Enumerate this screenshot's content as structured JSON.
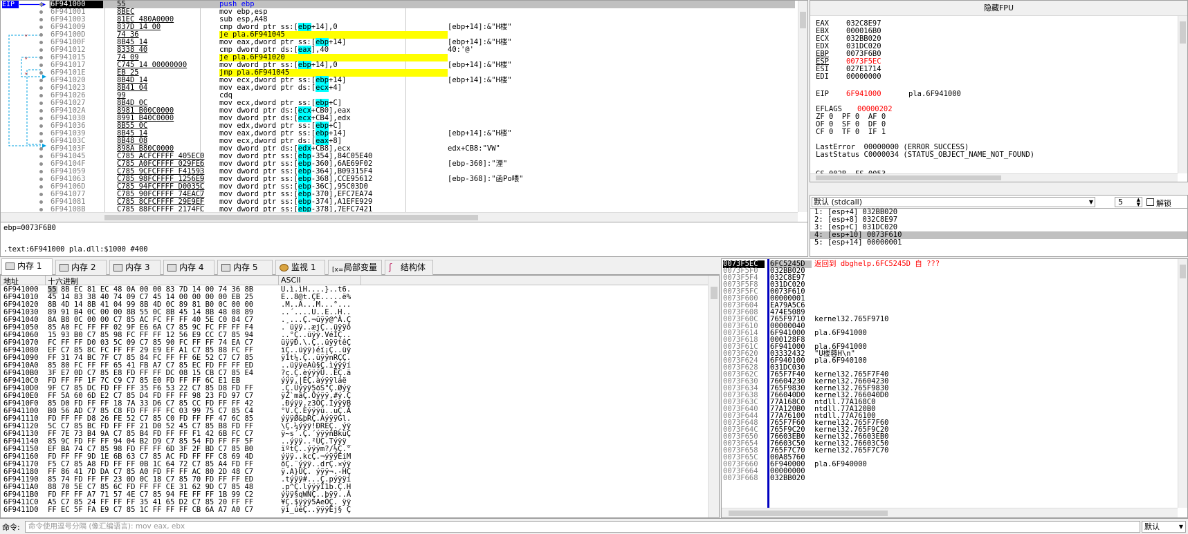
{
  "cpu": {
    "eip_tag": "EIP",
    "rows": [
      {
        "addr": "6F941000",
        "bytes": "55",
        "asm": "push ebp",
        "comment": "",
        "sel": true
      },
      {
        "addr": "6F941001",
        "bytes": "8BEC",
        "asm": "mov ebp,esp",
        "comment": ""
      },
      {
        "addr": "6F941003",
        "bytes": "81EC 480A0000",
        "asm": "sub esp,A48",
        "comment": ""
      },
      {
        "addr": "6F941009",
        "bytes": "837D 14 00",
        "asm": "cmp dword ptr ss:[ebp+14],0",
        "comment": "[ebp+14]:&\"H楼\""
      },
      {
        "addr": "6F94100D",
        "bytes": "74 36",
        "asm": "je pla.6F941045",
        "comment": "",
        "jump": true,
        "mark": "v"
      },
      {
        "addr": "6F94100F",
        "bytes": "8B45 14",
        "asm": "mov eax,dword ptr ss:[ebp+14]",
        "comment": "[ebp+14]:&\"H楼\""
      },
      {
        "addr": "6F941012",
        "bytes": "8338 40",
        "asm": "cmp dword ptr ds:[eax],40",
        "comment": "40:'@'"
      },
      {
        "addr": "6F941015",
        "bytes": "74 09",
        "asm": "je pla.6F941020",
        "comment": "",
        "jump": true,
        "mark": "v"
      },
      {
        "addr": "6F941017",
        "bytes": "C745 14 00000000",
        "asm": "mov dword ptr ss:[ebp+14],0",
        "comment": "[ebp+14]:&\"H楼\""
      },
      {
        "addr": "6F94101E",
        "bytes": "EB 25",
        "asm": "jmp pla.6F941045",
        "comment": "",
        "jump": true,
        "mark": "v"
      },
      {
        "addr": "6F941020",
        "bytes": "8B4D 14",
        "asm": "mov ecx,dword ptr ss:[ebp+14]",
        "comment": "[ebp+14]:&\"H楼\""
      },
      {
        "addr": "6F941023",
        "bytes": "8B41 04",
        "asm": "mov eax,dword ptr ds:[ecx+4]",
        "comment": ""
      },
      {
        "addr": "6F941026",
        "bytes": "99",
        "asm": "cdq",
        "comment": ""
      },
      {
        "addr": "6F941027",
        "bytes": "8B4D 0C",
        "asm": "mov ecx,dword ptr ss:[ebp+C]",
        "comment": ""
      },
      {
        "addr": "6F94102A",
        "bytes": "8981 B00C0000",
        "asm": "mov dword ptr ds:[ecx+CB0],eax",
        "comment": ""
      },
      {
        "addr": "6F941030",
        "bytes": "8991 B40C0000",
        "asm": "mov dword ptr ds:[ecx+CB4],edx",
        "comment": ""
      },
      {
        "addr": "6F941036",
        "bytes": "8B55 0C",
        "asm": "mov edx,dword ptr ss:[ebp+C]",
        "comment": ""
      },
      {
        "addr": "6F941039",
        "bytes": "8B45 14",
        "asm": "mov eax,dword ptr ss:[ebp+14]",
        "comment": "[ebp+14]:&\"H楼\""
      },
      {
        "addr": "6F94103C",
        "bytes": "8B48 08",
        "asm": "mov ecx,dword ptr ds:[eax+8]",
        "comment": ""
      },
      {
        "addr": "6F94103F",
        "bytes": "898A B80C0000",
        "asm": "mov dword ptr ds:[edx+CB8],ecx",
        "comment": "edx+CB8:\"VW\""
      },
      {
        "addr": "6F941045",
        "bytes": "C785 ACFCFFFF 405EC0",
        "asm": "mov dword ptr ss:[ebp-354],84C05E40",
        "comment": ""
      },
      {
        "addr": "6F94104F",
        "bytes": "C785 A0FCFFFF 029FE6",
        "asm": "mov dword ptr ss:[ebp-360],6AE69F02",
        "comment": "[ebp-360]:\"湮\""
      },
      {
        "addr": "6F941059",
        "bytes": "C785 9CFCFFFF F41593",
        "asm": "mov dword ptr ss:[ebp-364],B09315F4",
        "comment": ""
      },
      {
        "addr": "6F941063",
        "bytes": "C785 98FCFFFF 1256E9",
        "asm": "mov dword ptr ss:[ebp-368],CCE95612",
        "comment": "[ebp-368]:\"函Po喂\""
      },
      {
        "addr": "6F94106D",
        "bytes": "C785 94FCFFFF D0035C",
        "asm": "mov dword ptr ss:[ebp-36C],95C03D0",
        "comment": ""
      },
      {
        "addr": "6F941077",
        "bytes": "C785 90FCFFFF 74EAC7",
        "asm": "mov dword ptr ss:[ebp-370],EFC7EA74",
        "comment": ""
      },
      {
        "addr": "6F941081",
        "bytes": "C785 8CFCFFFF 29E9EF",
        "asm": "mov dword ptr ss:[ebp-374],A1EFE929",
        "comment": ""
      },
      {
        "addr": "6F94108B",
        "bytes": "C785 88FCFFFF 2174FC",
        "asm": "mov dword ptr ss:[ebp-378],7EFC7421",
        "comment": ""
      }
    ]
  },
  "info": {
    "line1": "ebp=0073F6B0",
    "line2": ".text:6F941000 pla.dll:$1000 #400"
  },
  "registers": {
    "title": "隐藏FPU",
    "gp": [
      {
        "n": "EAX",
        "v": "032C8E97"
      },
      {
        "n": "EBX",
        "v": "000016B0"
      },
      {
        "n": "ECX",
        "v": "032BB020"
      },
      {
        "n": "EDX",
        "v": "031DC020"
      },
      {
        "n": "EBP",
        "v": "0073F6B0",
        "u": true
      },
      {
        "n": "ESP",
        "v": "0073F5EC",
        "u": true,
        "red": true
      },
      {
        "n": "ESI",
        "v": "027E1714"
      },
      {
        "n": "EDI",
        "v": "00000000"
      }
    ],
    "eip": {
      "n": "EIP",
      "v": "6F941000",
      "s": "pla.6F941000"
    },
    "eflags": {
      "n": "EFLAGS",
      "v": "00000202"
    },
    "flags": [
      "ZF 0  PF 0  AF 0",
      "OF 0  SF 0  DF 0",
      "CF 0  TF 0  IF 1"
    ],
    "lasterror": "LastError  00000000 (ERROR_SUCCESS)",
    "laststatus": "LastStatus C0000034 (STATUS_OBJECT_NAME_NOT_FOUND)",
    "segs": "GS 002B  FS 0053"
  },
  "callconv": {
    "label": "默认 (stdcall)",
    "count": "5",
    "unlock": "解锁"
  },
  "args": [
    "1: [esp+4] 032BB020",
    "2: [esp+8] 032C8E97",
    "3: [esp+C] 031DC020",
    "4: [esp+10] 0073F610",
    "5: [esp+14] 00000001"
  ],
  "tabs": [
    "内存 1",
    "内存 2",
    "内存 3",
    "内存 4",
    "内存 5",
    "监视 1",
    "局部变量",
    "结构体"
  ],
  "dump": {
    "col_addr": "地址",
    "col_hex": "十六进制",
    "col_ascii": "ASCII",
    "rows": [
      {
        "a": "6F941000",
        "h": "55 8B EC 81 EC 48 0A 00 00 83 7D 14 00 74 36 8B",
        "c": "U.ì.ìH....}..t6."
      },
      {
        "a": "6F941010",
        "h": "45 14 83 38 40 74 09 C7 45 14 00 00 00 00 EB 25",
        "c": "E..8@t.ÇE.....ë%"
      },
      {
        "a": "6F941020",
        "h": "8B 4D 14 8B 41 04 99 8B 4D 0C 89 81 B0 0C 00 00",
        "c": ".M..A...M...°..."
      },
      {
        "a": "6F941030",
        "h": "89 91 B4 0C 00 00 8B 55 0C 8B 45 14 8B 48 08 89",
        "c": "..´....U..E..H.."
      },
      {
        "a": "6F941040",
        "h": "8A B8 0C 00 00 C7 85 AC FC FF FF 40 5E C0 84 C7",
        "c": ".¸...Ç.¬üÿÿ@^À.Ç"
      },
      {
        "a": "6F941050",
        "h": "85 A0 FC FF FF 02 9F E6 6A C7 85 9C FC FF FF F4",
        "c": ". üÿÿ..æjÇ..üÿÿô"
      },
      {
        "a": "6F941060",
        "h": "15 93 B0 C7 85 98 FC FF FF 12 56 E9 CC C7 85 94",
        "c": "..°Ç..üÿÿ.VéÌÇ.."
      },
      {
        "a": "6F941070",
        "h": "FC FF FF D0 03 5C 09 C7 85 90 FC FF FF 74 EA C7",
        "c": "üÿÿÐ.\\.Ç..üÿÿtêÇ"
      },
      {
        "a": "6F941080",
        "h": "EF C7 85 8C FC FF FF 29 E9 EF A1 C7 85 88 FC FF",
        "c": "ïÇ..üÿÿ)éï¡Ç..üÿ"
      },
      {
        "a": "6F941090",
        "h": "FF 31 74 BC 7F C7 85 84 FC FF FF 6E 52 C7 C7 85",
        "c": "ÿ1t¼.Ç..üÿÿnRÇÇ."
      },
      {
        "a": "6F9410A0",
        "h": "85 80 FC FF FF 65 41 FB A7 C7 85 EC FD FF FF ED",
        "c": "..üÿÿeAû§Ç.ìýÿÿí"
      },
      {
        "a": "6F9410B0",
        "h": "3F E7 0D C7 85 E8 FD FF FF DC 08 15 CB C7 85 E4",
        "c": "?ç.Ç.èýÿÿÜ..ËÇ.ä"
      },
      {
        "a": "6F9410C0",
        "h": "FD FF FF 1F 7C C9 C7 85 E0 FD FF FF 6C E1 EB",
        "c": "ýÿÿ.|ÉÇ.àýÿÿláë"
      },
      {
        "a": "6F9410D0",
        "h": "9F C7 85 DC FD FF FF 35 F6 53 22 C7 85 D8 FD FF",
        "c": ".Ç.Üýÿÿ5öS\"Ç.Øýÿ"
      },
      {
        "a": "6F9410E0",
        "h": "FF 5A 60 6D E2 C7 85 D4 FD FF FF 98 23 FD 97 C7",
        "c": "ÿZ`mâÇ.Ôýÿÿ.#ý.Ç"
      },
      {
        "a": "6F9410F0",
        "h": "85 D0 FD FF FF 18 7A 33 D6 C7 85 CC FD FF FF 42",
        "c": ".Ðýÿÿ.z3ÖÇ.ÌýÿÿB"
      },
      {
        "a": "6F941100",
        "h": "B0 56 AD C7 85 C8 FD FF FF FC 03 99 75 C7 85 C4",
        "c": "°V.Ç.Èýÿÿü..uÇ.Ä"
      },
      {
        "a": "6F941110",
        "h": "FD FF FF D8 26 FE 52 C7 85 C0 FD FF FF 47 6C 85",
        "c": "ýÿÿØ&þRÇ.ÀýÿÿGl."
      },
      {
        "a": "6F941120",
        "h": "5C C7 85 BC FD FF FF 21 D0 52 45 C7 85 B8 FD FF",
        "c": "\\Ç.¼ýÿÿ!ÐREÇ.¸ýÿ"
      },
      {
        "a": "6F941130",
        "h": "FF 7E 73 B4 9A C7 85 B4 FD FF FF F1 42 6B FC C7",
        "c": "ÿ~s´.Ç.´ýÿÿñBküÇ"
      },
      {
        "a": "6F941140",
        "h": "85 9C FD FF FF 94 04 B2 D9 C7 85 54 FD FF FF 5F",
        "c": "..ýÿÿ..²ÙÇ.Týÿÿ_"
      },
      {
        "a": "6F941150",
        "h": "EF BA 74 C7 85 98 FD FF FF 6D 3F 2F BD C7 85 B0",
        "c": "ïºtÇ..ýÿÿm?/½Ç.°"
      },
      {
        "a": "6F941160",
        "h": "FD FF FF 9D 1E 6B 63 C7 85 AC FD FF FF C8 69 4D",
        "c": "ýÿÿ..kcÇ.¬ýÿÿÈiM"
      },
      {
        "a": "6F941170",
        "h": "F5 C7 85 A8 FD FF FF 0B 1C 64 72 C7 85 A4 FD FF",
        "c": "õÇ.¨ýÿÿ..drÇ.¤ýÿ"
      },
      {
        "a": "6F941180",
        "h": "FF 86 41 7D DA C7 85 A0 FD FF FF AC 80 2D 48 C7",
        "c": "ÿ.A}ÚÇ. ýÿÿ¬.-HÇ"
      },
      {
        "a": "6F941190",
        "h": "85 74 FD FF FF 23 0D 0C 18 C7 85 70 FD FF FF ED",
        "c": ".týÿÿ#...Ç.pýÿÿí"
      },
      {
        "a": "6F9411A0",
        "h": "88 70 5E C7 85 6C FD FF FF CE 31 62 9D C7 85 48",
        "c": ".p^Ç.lýÿÿÎ1b.Ç.H"
      },
      {
        "a": "6F9411B0",
        "h": "FD FF FF A7 71 57 4E C7 85 94 FE FF FF 1B 99 C2",
        "c": "ýÿÿ§qWNÇ..þÿÿ..Â"
      },
      {
        "a": "6F9411C0",
        "h": "A5 C7 85 24 FF FF FF 35 41 65 D2 C7 85 20 FF FF",
        "c": "¥Ç.$ÿÿÿ5AeÒÇ. ÿÿ"
      },
      {
        "a": "6F9411D0",
        "h": "FF EC 5F FA E9 C7 85 1C FF FF FF CB 6A A7 A0 C7",
        "c": "ÿì_úéÇ..ÿÿÿËj§ Ç"
      }
    ]
  },
  "stack": {
    "rows": [
      {
        "a": "0073F5EC",
        "v": "6FC5245D",
        "c": "返回到 dbghelp.6FC5245D 自 ???",
        "sel": true,
        "cred": true
      },
      {
        "a": "0073F5F0",
        "v": "032BB020",
        "c": ""
      },
      {
        "a": "0073F5F4",
        "v": "032C8E97",
        "c": ""
      },
      {
        "a": "0073F5F8",
        "v": "031DC020",
        "c": ""
      },
      {
        "a": "0073F5FC",
        "v": "0073F610",
        "c": ""
      },
      {
        "a": "0073F600",
        "v": "00000001",
        "c": ""
      },
      {
        "a": "0073F604",
        "v": "EA79A5C6",
        "c": ""
      },
      {
        "a": "0073F608",
        "v": "474E5089",
        "c": ""
      },
      {
        "a": "0073F60C",
        "v": "765F9710",
        "c": "kernel32.765F9710",
        "ared": true
      },
      {
        "a": "0073F610",
        "v": "00000040",
        "c": ""
      },
      {
        "a": "0073F614",
        "v": "6F941000",
        "c": "pla.6F941000"
      },
      {
        "a": "0073F618",
        "v": "000128F8",
        "c": ""
      },
      {
        "a": "0073F61C",
        "v": "6F941000",
        "c": "pla.6F941000"
      },
      {
        "a": "0073F620",
        "v": "03332432",
        "c": "\"U楼蓉H\\n\""
      },
      {
        "a": "0073F624",
        "v": "6F940100",
        "c": "pla.6F940100"
      },
      {
        "a": "0073F628",
        "v": "031DC030",
        "c": ""
      },
      {
        "a": "0073F62C",
        "v": "765F7F40",
        "c": "kernel32.765F7F40",
        "ared": true
      },
      {
        "a": "0073F630",
        "v": "76604230",
        "c": "kernel32.76604230",
        "ared": true
      },
      {
        "a": "0073F634",
        "v": "765F9830",
        "c": "kernel32.765F9830",
        "ared": true
      },
      {
        "a": "0073F638",
        "v": "766040D0",
        "c": "kernel32.766040D0",
        "ared": true
      },
      {
        "a": "0073F63C",
        "v": "77A168C0",
        "c": "ntdll.77A168C0",
        "ared": true
      },
      {
        "a": "0073F640",
        "v": "77A120B0",
        "c": "ntdll.77A120B0",
        "ared": true
      },
      {
        "a": "0073F644",
        "v": "77A76100",
        "c": "ntdll.77A76100",
        "ared": true
      },
      {
        "a": "0073F648",
        "v": "765F7F60",
        "c": "kernel32.765F7F60",
        "ared": true
      },
      {
        "a": "0073F64C",
        "v": "765F9C20",
        "c": "kernel32.765F9C20",
        "ared": true
      },
      {
        "a": "0073F650",
        "v": "76603EB0",
        "c": "kernel32.76603EB0",
        "ared": true
      },
      {
        "a": "0073F654",
        "v": "76603C50",
        "c": "kernel32.76603C50",
        "ared": true
      },
      {
        "a": "0073F658",
        "v": "765F7C70",
        "c": "kernel32.765F7C70",
        "ared": true
      },
      {
        "a": "0073F65C",
        "v": "00A85760",
        "c": ""
      },
      {
        "a": "0073F660",
        "v": "6F940000",
        "c": "pla.6F940000"
      },
      {
        "a": "0073F664",
        "v": "00000000",
        "c": ""
      },
      {
        "a": "0073F668",
        "v": "032BB020",
        "c": ""
      }
    ]
  },
  "command": {
    "label": "命令:",
    "placeholder": "命令使用逗号分隔 (像汇编语言): mov eax, ebx",
    "mode": "默认"
  },
  "colors": {
    "highlight_yellow": "#ffff00",
    "highlight_cyan": "#00ffff",
    "addr_gray": "#808080",
    "red": "#ff0000",
    "eip_blue": "#0000ff"
  }
}
